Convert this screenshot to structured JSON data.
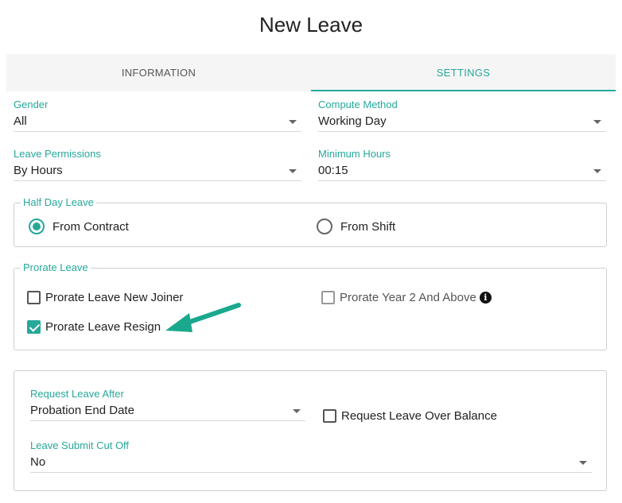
{
  "page": {
    "title": "New Leave"
  },
  "tabs": [
    {
      "label": "INFORMATION",
      "active": false
    },
    {
      "label": "SETTINGS",
      "active": true
    }
  ],
  "fields": {
    "gender": {
      "label": "Gender",
      "value": "All"
    },
    "compute_method": {
      "label": "Compute Method",
      "value": "Working Day"
    },
    "leave_permissions": {
      "label": "Leave Permissions",
      "value": "By Hours"
    },
    "minimum_hours": {
      "label": "Minimum Hours",
      "value": "00:15"
    }
  },
  "half_day_leave": {
    "legend": "Half Day Leave",
    "options": [
      {
        "label": "From Contract",
        "selected": true
      },
      {
        "label": "From Shift",
        "selected": false
      }
    ]
  },
  "prorate_leave": {
    "legend": "Prorate Leave",
    "new_joiner": {
      "label": "Prorate Leave New Joiner",
      "checked": false
    },
    "year2": {
      "label": "Prorate Year 2 And Above",
      "checked": false,
      "icon": "info-icon"
    },
    "resign": {
      "label": "Prorate Leave Resign",
      "checked": true
    }
  },
  "request": {
    "request_leave_after": {
      "label": "Request Leave After",
      "value": "Probation End Date"
    },
    "over_balance": {
      "label": "Request Leave Over Balance",
      "checked": false
    },
    "submit_cut_off": {
      "label": "Leave Submit Cut Off",
      "value": "No"
    }
  },
  "annotation": {
    "icon": "arrow-annotation",
    "color": "#1aa88e"
  },
  "colors": {
    "accent": "#26a89a"
  }
}
